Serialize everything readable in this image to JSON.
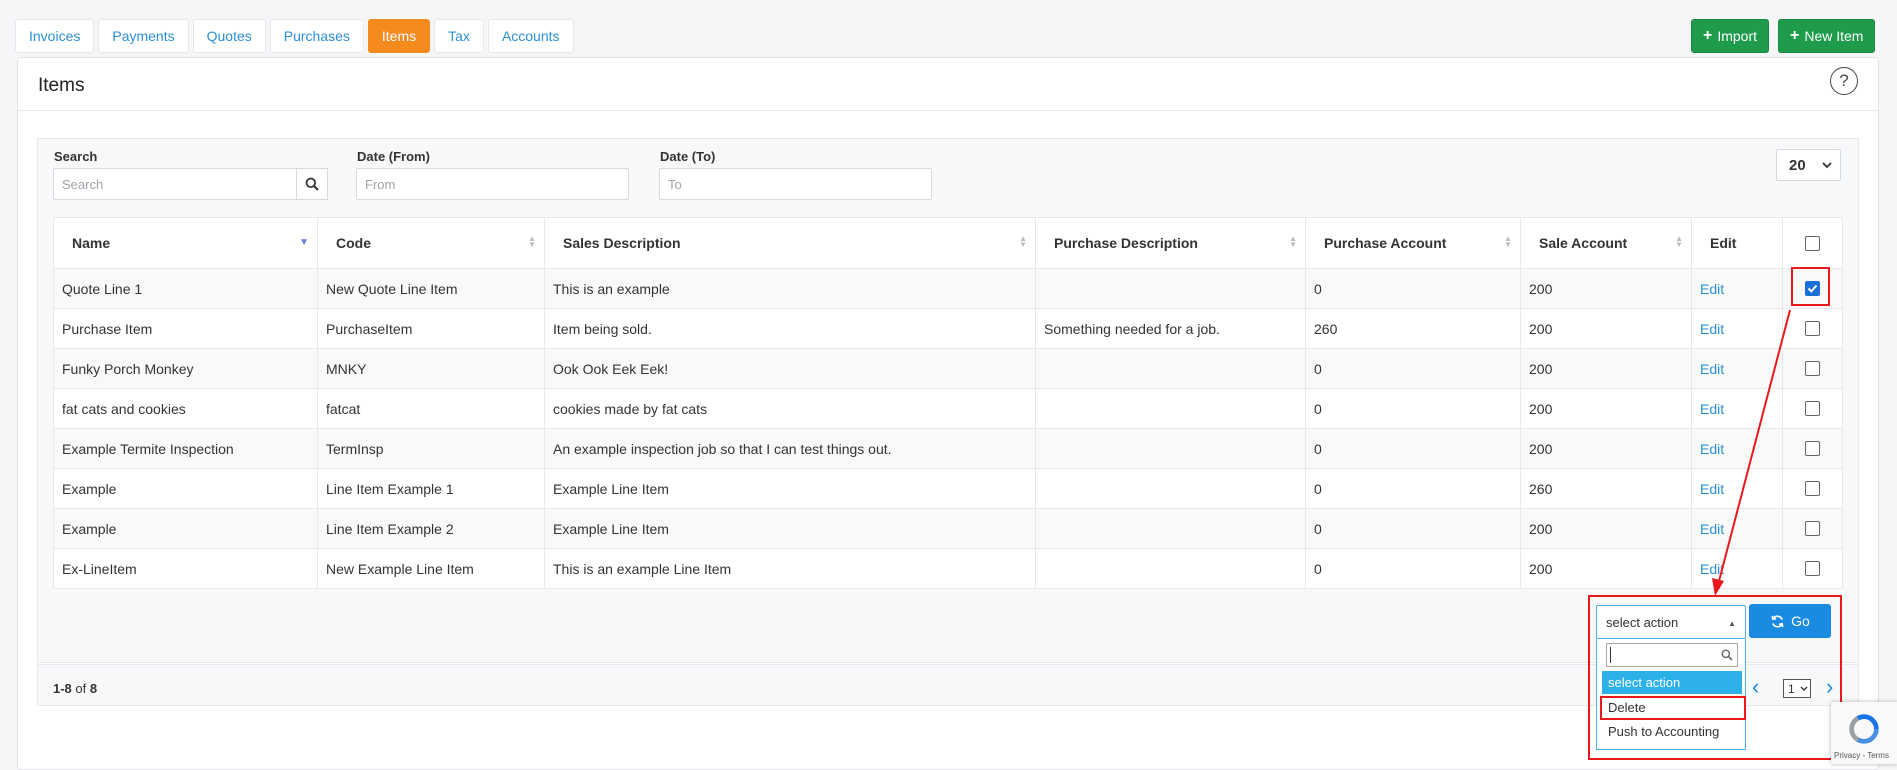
{
  "tabs": [
    {
      "label": "Invoices"
    },
    {
      "label": "Payments"
    },
    {
      "label": "Quotes"
    },
    {
      "label": "Purchases"
    },
    {
      "label": "Items",
      "active": true
    },
    {
      "label": "Tax"
    },
    {
      "label": "Accounts"
    }
  ],
  "toolbar": {
    "import_label": "Import",
    "new_item_label": "New Item"
  },
  "page": {
    "title": "Items"
  },
  "filters": {
    "search_label": "Search",
    "search_placeholder": "Search",
    "date_from_label": "Date (From)",
    "date_from_placeholder": "From",
    "date_to_label": "Date (To)",
    "date_to_placeholder": "To",
    "page_size": "20"
  },
  "table": {
    "columns": [
      "Name",
      "Code",
      "Sales Description",
      "Purchase Description",
      "Purchase Account",
      "Sale Account",
      "Edit"
    ],
    "edit_label": "Edit",
    "rows": [
      {
        "name": "Quote Line 1",
        "code": "New Quote Line Item",
        "sales_description": "This is an example",
        "purchase_description": "",
        "purchase_account": "0",
        "sale_account": "200",
        "checked": true
      },
      {
        "name": "Purchase Item",
        "code": "PurchaseItem",
        "sales_description": "Item being sold.",
        "purchase_description": "Something needed for a job.",
        "purchase_account": "260",
        "sale_account": "200",
        "checked": false
      },
      {
        "name": "Funky Porch Monkey",
        "code": "MNKY",
        "sales_description": "Ook Ook Eek Eek!",
        "purchase_description": "",
        "purchase_account": "0",
        "sale_account": "200",
        "checked": false
      },
      {
        "name": "fat cats and cookies",
        "code": "fatcat",
        "sales_description": "cookies made by fat cats",
        "purchase_description": "",
        "purchase_account": "0",
        "sale_account": "200",
        "checked": false
      },
      {
        "name": "Example Termite Inspection",
        "code": "TermInsp",
        "sales_description": "An example inspection job so that I can test things out.",
        "purchase_description": "",
        "purchase_account": "0",
        "sale_account": "200",
        "checked": false
      },
      {
        "name": "Example",
        "code": "Line Item Example 1",
        "sales_description": "Example Line Item",
        "purchase_description": "",
        "purchase_account": "0",
        "sale_account": "260",
        "checked": false
      },
      {
        "name": "Example",
        "code": "Line Item Example 2",
        "sales_description": "Example Line Item",
        "purchase_description": "",
        "purchase_account": "0",
        "sale_account": "200",
        "checked": false
      },
      {
        "name": "Ex-LineItem",
        "code": "New Example Line Item",
        "sales_description": "This is an example Line Item",
        "purchase_description": "",
        "purchase_account": "0",
        "sale_account": "200",
        "checked": false
      }
    ]
  },
  "bulk": {
    "selected": "select action",
    "options": [
      "select action",
      "Delete",
      "Push to Accounting"
    ],
    "go_label": "Go"
  },
  "pagination": {
    "range": "1-8",
    "of_label": "of",
    "total": "8",
    "current_page": "1"
  },
  "recaptcha": {
    "label": "Privacy - Terms"
  },
  "colors": {
    "accent": "#f58a1f",
    "primary": "#1a8be0",
    "success": "#1e9b4b",
    "link": "#2b8fd4",
    "annotation": "#e8191c"
  }
}
